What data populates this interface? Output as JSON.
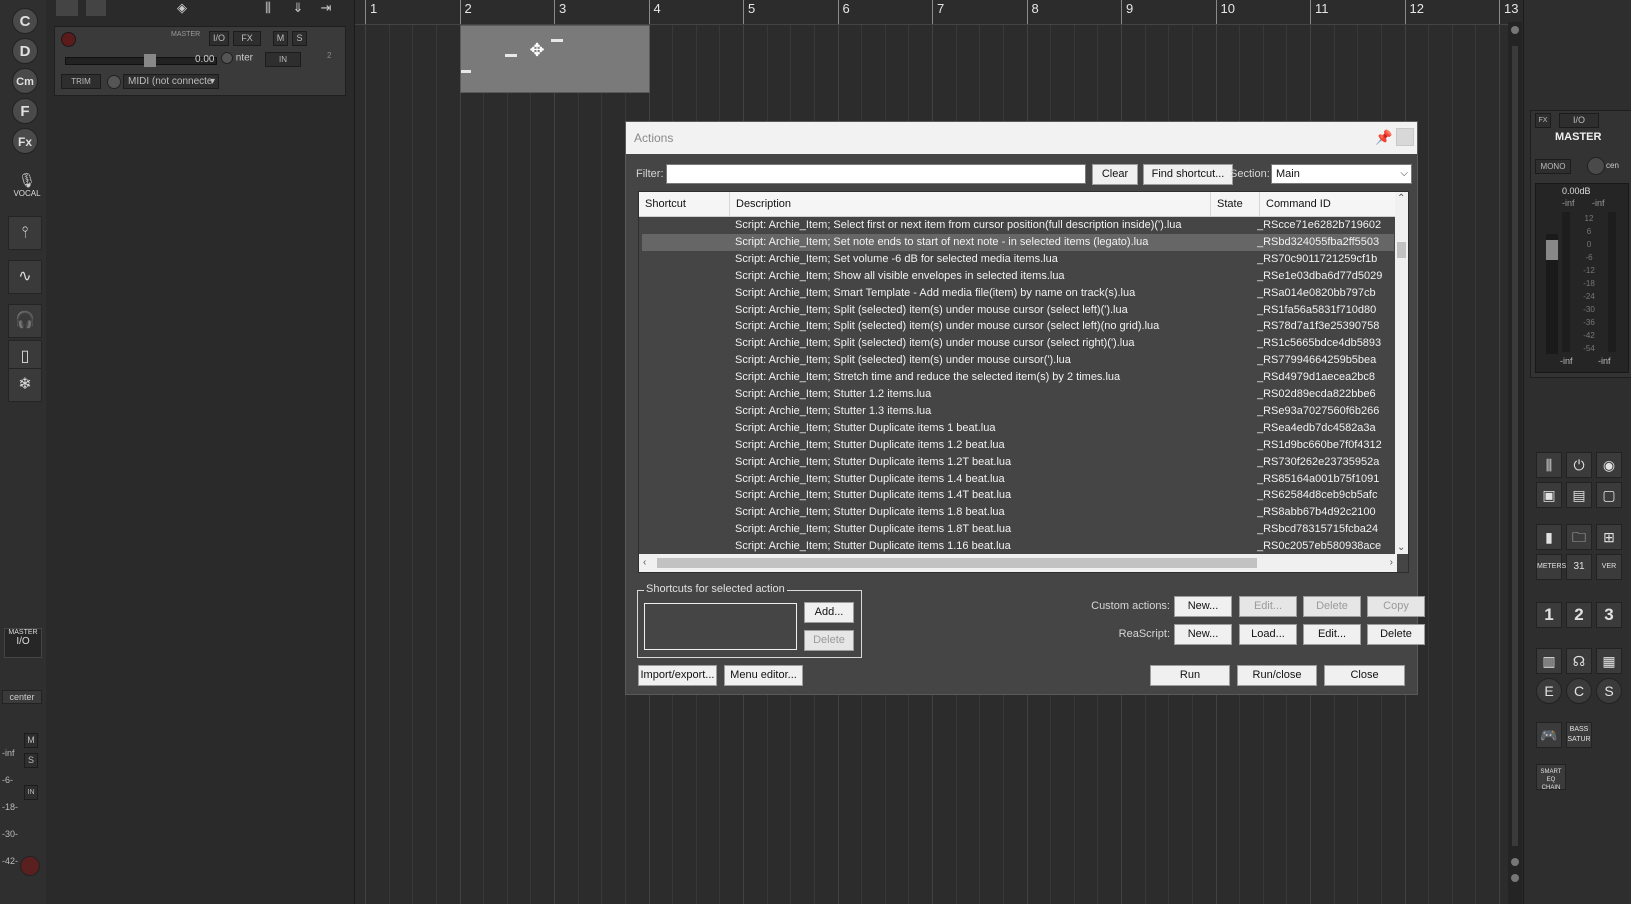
{
  "left_strip": {
    "round_buttons": [
      "C",
      "D",
      "Cm",
      "F",
      "Fx"
    ],
    "vocal_label": "VOCAL",
    "master_label": "MASTER",
    "io_label": "I/O",
    "center_label": "center",
    "meter_ticks": [
      "-inf",
      "-6-",
      "-18-",
      "-30-",
      "-42-"
    ],
    "m_label": "M",
    "s_label": "S",
    "in_label": "IN"
  },
  "track": {
    "io_label": "I/O",
    "fx_label": "FX",
    "m_label": "M",
    "s_label": "S",
    "master_small": "MASTER",
    "volume": "0.00",
    "pan": "nter",
    "in_label": "IN",
    "trim_label": "TRIM",
    "midi_input": "MIDI (not connecte",
    "track_number": "2"
  },
  "ruler": {
    "marks": [
      "1",
      "2",
      "3",
      "4",
      "5",
      "6",
      "7",
      "8",
      "9",
      "10",
      "11",
      "12",
      "13"
    ]
  },
  "master": {
    "io_label": "I/O",
    "fx_label": "FX",
    "title": "MASTER",
    "mono_label": "MONO",
    "pan_label": "cen",
    "db_readout": "0.00dB",
    "peak_left": "-inf",
    "peak_right": "-inf",
    "bottom_left": "-inf",
    "bottom_right": "-inf",
    "scale": [
      "12",
      "6",
      "0",
      "-6",
      "-12",
      "-18",
      "-24",
      "-30",
      "-36",
      "-42",
      "-54"
    ]
  },
  "toolbar": {
    "meters_label": "METERS",
    "calendar_number": "31",
    "ver_label": "VER",
    "num_buttons": [
      "1",
      "2",
      "3"
    ],
    "ecs_buttons": [
      "E",
      "C",
      "S"
    ],
    "bass_label": "BASS SATUR",
    "smart_label": "SMART EQ CHAIN"
  },
  "actions": {
    "title": "Actions",
    "filter_label": "Filter:",
    "filter_value": "",
    "clear_button": "Clear",
    "find_shortcut_button": "Find shortcut...",
    "section_label": "Section:",
    "section_value": "Main",
    "columns": [
      "Shortcut",
      "Description",
      "State",
      "Command ID"
    ],
    "rows": [
      {
        "shortcut": "",
        "description": "Script: Archie_Item;  Select first or next item from cursor position(full description inside)(').lua",
        "state": "",
        "command_id": "_RScce71e6282b719602",
        "selected": false
      },
      {
        "shortcut": "",
        "description": "Script: Archie_Item;  Set note ends to start of next note - in selected items (legato).lua",
        "state": "",
        "command_id": "_RSbd324055fba2ff5503",
        "selected": true
      },
      {
        "shortcut": "",
        "description": "Script: Archie_Item;  Set volume -6 dB for selected media items.lua",
        "state": "",
        "command_id": "_RS70c9011721259cf1b",
        "selected": false
      },
      {
        "shortcut": "",
        "description": "Script: Archie_Item;  Show all visible envelopes in selected items.lua",
        "state": "",
        "command_id": "_RSe1e03dba6d77d5029",
        "selected": false
      },
      {
        "shortcut": "",
        "description": "Script: Archie_Item;  Smart Template - Add media file(item) by name on track(s).lua",
        "state": "",
        "command_id": "_RSa014e0820bb797cb",
        "selected": false
      },
      {
        "shortcut": "",
        "description": "Script: Archie_Item;  Split (selected) item(s) under mouse cursor (select left)(').lua",
        "state": "",
        "command_id": "_RS1fa56a5831f710d80",
        "selected": false
      },
      {
        "shortcut": "",
        "description": "Script: Archie_Item;  Split (selected) item(s) under mouse cursor (select left)(no grid).lua",
        "state": "",
        "command_id": "_RS78d7a1f3e25390758",
        "selected": false
      },
      {
        "shortcut": "",
        "description": "Script: Archie_Item;  Split (selected) item(s) under mouse cursor (select right)(').lua",
        "state": "",
        "command_id": "_RS1c5665bdce4db5893",
        "selected": false
      },
      {
        "shortcut": "",
        "description": "Script: Archie_Item;  Split (selected) item(s) under mouse cursor(').lua",
        "state": "",
        "command_id": "_RS77994664259b5bea",
        "selected": false
      },
      {
        "shortcut": "",
        "description": "Script: Archie_Item;  Stretch time and reduce the selected item(s) by 2 times.lua",
        "state": "",
        "command_id": "_RSd4979d1aecea2bc8",
        "selected": false
      },
      {
        "shortcut": "",
        "description": "Script: Archie_Item;  Stutter 1.2 items.lua",
        "state": "",
        "command_id": "_RS02d89ecda822bbe6",
        "selected": false
      },
      {
        "shortcut": "",
        "description": "Script: Archie_Item;  Stutter 1.3 items.lua",
        "state": "",
        "command_id": "_RSe93a7027560f6b266",
        "selected": false
      },
      {
        "shortcut": "",
        "description": "Script: Archie_Item;  Stutter Duplicate items 1 beat.lua",
        "state": "",
        "command_id": "_RSea4edb7dc4582a3a",
        "selected": false
      },
      {
        "shortcut": "",
        "description": "Script: Archie_Item;  Stutter Duplicate items 1.2 beat.lua",
        "state": "",
        "command_id": "_RS1d9bc660be7f0f4312",
        "selected": false
      },
      {
        "shortcut": "",
        "description": "Script: Archie_Item;  Stutter Duplicate items 1.2T beat.lua",
        "state": "",
        "command_id": "_RS730f262e23735952a",
        "selected": false
      },
      {
        "shortcut": "",
        "description": "Script: Archie_Item;  Stutter Duplicate items 1.4 beat.lua",
        "state": "",
        "command_id": "_RS85164a001b75f1091",
        "selected": false
      },
      {
        "shortcut": "",
        "description": "Script: Archie_Item;  Stutter Duplicate items 1.4T beat.lua",
        "state": "",
        "command_id": "_RS62584d8ceb9cb5afc",
        "selected": false
      },
      {
        "shortcut": "",
        "description": "Script: Archie_Item;  Stutter Duplicate items 1.8 beat.lua",
        "state": "",
        "command_id": "_RS8abb67b4d92c2100",
        "selected": false
      },
      {
        "shortcut": "",
        "description": "Script: Archie_Item;  Stutter Duplicate items 1.8T beat.lua",
        "state": "",
        "command_id": "_RSbcd78315715fcba24",
        "selected": false
      },
      {
        "shortcut": "",
        "description": "Script: Archie_Item;  Stutter Duplicate items 1.16 beat.lua",
        "state": "",
        "command_id": "_RS0c2057eb580938ace",
        "selected": false
      }
    ],
    "shortcuts_group_label": "Shortcuts for selected action",
    "add_button": "Add...",
    "delete_shortcut_button": "Delete",
    "custom_actions_label": "Custom actions:",
    "custom_new": "New...",
    "custom_edit": "Edit...",
    "custom_delete": "Delete",
    "custom_copy": "Copy",
    "reascript_label": "ReaScript:",
    "reascript_new": "New...",
    "reascript_load": "Load...",
    "reascript_edit": "Edit...",
    "reascript_delete": "Delete",
    "import_export_button": "Import/export...",
    "menu_editor_button": "Menu editor...",
    "run_button": "Run",
    "run_close_button": "Run/close",
    "close_button": "Close"
  },
  "colors": {
    "background": "#2b2b2b",
    "dialog_bg": "#454545",
    "dialog_title_bg": "#f2f2f2",
    "selected_row": "#666666",
    "media_item": "#7a7a7a"
  }
}
